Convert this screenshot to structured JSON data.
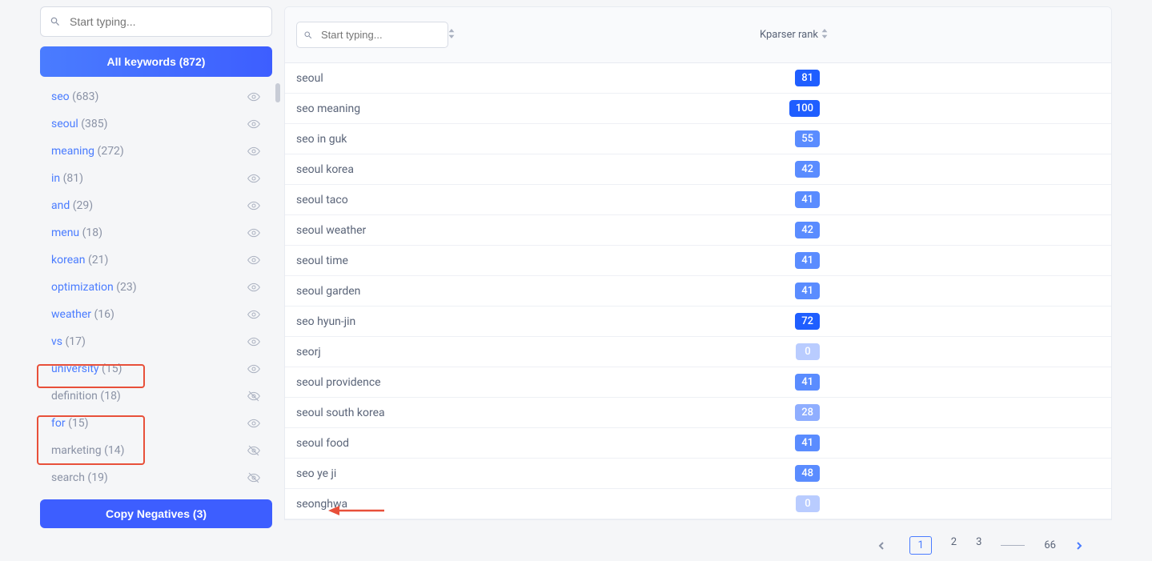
{
  "sidebar": {
    "search_placeholder": "Start typing...",
    "all_label": "All keywords",
    "all_count": "(872)",
    "items": [
      {
        "kw": "seo",
        "count": "(683)",
        "muted": false,
        "hidden": false
      },
      {
        "kw": "seoul",
        "count": "(385)",
        "muted": false,
        "hidden": false
      },
      {
        "kw": "meaning",
        "count": "(272)",
        "muted": false,
        "hidden": false
      },
      {
        "kw": "in",
        "count": "(81)",
        "muted": false,
        "hidden": false
      },
      {
        "kw": "and",
        "count": "(29)",
        "muted": false,
        "hidden": false
      },
      {
        "kw": "menu",
        "count": "(18)",
        "muted": false,
        "hidden": false
      },
      {
        "kw": "korean",
        "count": "(21)",
        "muted": false,
        "hidden": false
      },
      {
        "kw": "optimization",
        "count": "(23)",
        "muted": false,
        "hidden": false
      },
      {
        "kw": "weather",
        "count": "(16)",
        "muted": false,
        "hidden": false
      },
      {
        "kw": "vs",
        "count": "(17)",
        "muted": false,
        "hidden": false
      },
      {
        "kw": "university",
        "count": "(15)",
        "muted": false,
        "hidden": false
      },
      {
        "kw": "definition",
        "count": "(18)",
        "muted": true,
        "hidden": true
      },
      {
        "kw": "for",
        "count": "(15)",
        "muted": false,
        "hidden": false
      },
      {
        "kw": "marketing",
        "count": "(14)",
        "muted": true,
        "hidden": true
      },
      {
        "kw": "search",
        "count": "(19)",
        "muted": true,
        "hidden": true
      }
    ],
    "copy_label": "Copy Negatives",
    "copy_count": "(3)"
  },
  "main": {
    "search_placeholder": "Start typing...",
    "rank_header": "Kparser rank",
    "rows": [
      {
        "kw": "seoul",
        "rank": "81",
        "tone": "r-dark"
      },
      {
        "kw": "seo meaning",
        "rank": "100",
        "tone": "r-dark"
      },
      {
        "kw": "seo in guk",
        "rank": "55",
        "tone": "r-mid"
      },
      {
        "kw": "seoul korea",
        "rank": "42",
        "tone": "r-mid"
      },
      {
        "kw": "seoul taco",
        "rank": "41",
        "tone": "r-mid"
      },
      {
        "kw": "seoul weather",
        "rank": "42",
        "tone": "r-mid"
      },
      {
        "kw": "seoul time",
        "rank": "41",
        "tone": "r-mid"
      },
      {
        "kw": "seoul garden",
        "rank": "41",
        "tone": "r-mid"
      },
      {
        "kw": "seo hyun-jin",
        "rank": "72",
        "tone": "r-dark"
      },
      {
        "kw": "seorj",
        "rank": "0",
        "tone": "r-vlight"
      },
      {
        "kw": "seoul providence",
        "rank": "41",
        "tone": "r-mid"
      },
      {
        "kw": "seoul south korea",
        "rank": "28",
        "tone": "r-light"
      },
      {
        "kw": "seoul food",
        "rank": "41",
        "tone": "r-mid"
      },
      {
        "kw": "seo ye ji",
        "rank": "48",
        "tone": "r-mid"
      },
      {
        "kw": "seonghwa",
        "rank": "0",
        "tone": "r-vlight"
      }
    ]
  },
  "pagination": {
    "pages": [
      "1",
      "2",
      "3"
    ],
    "last": "66",
    "current": 0
  }
}
